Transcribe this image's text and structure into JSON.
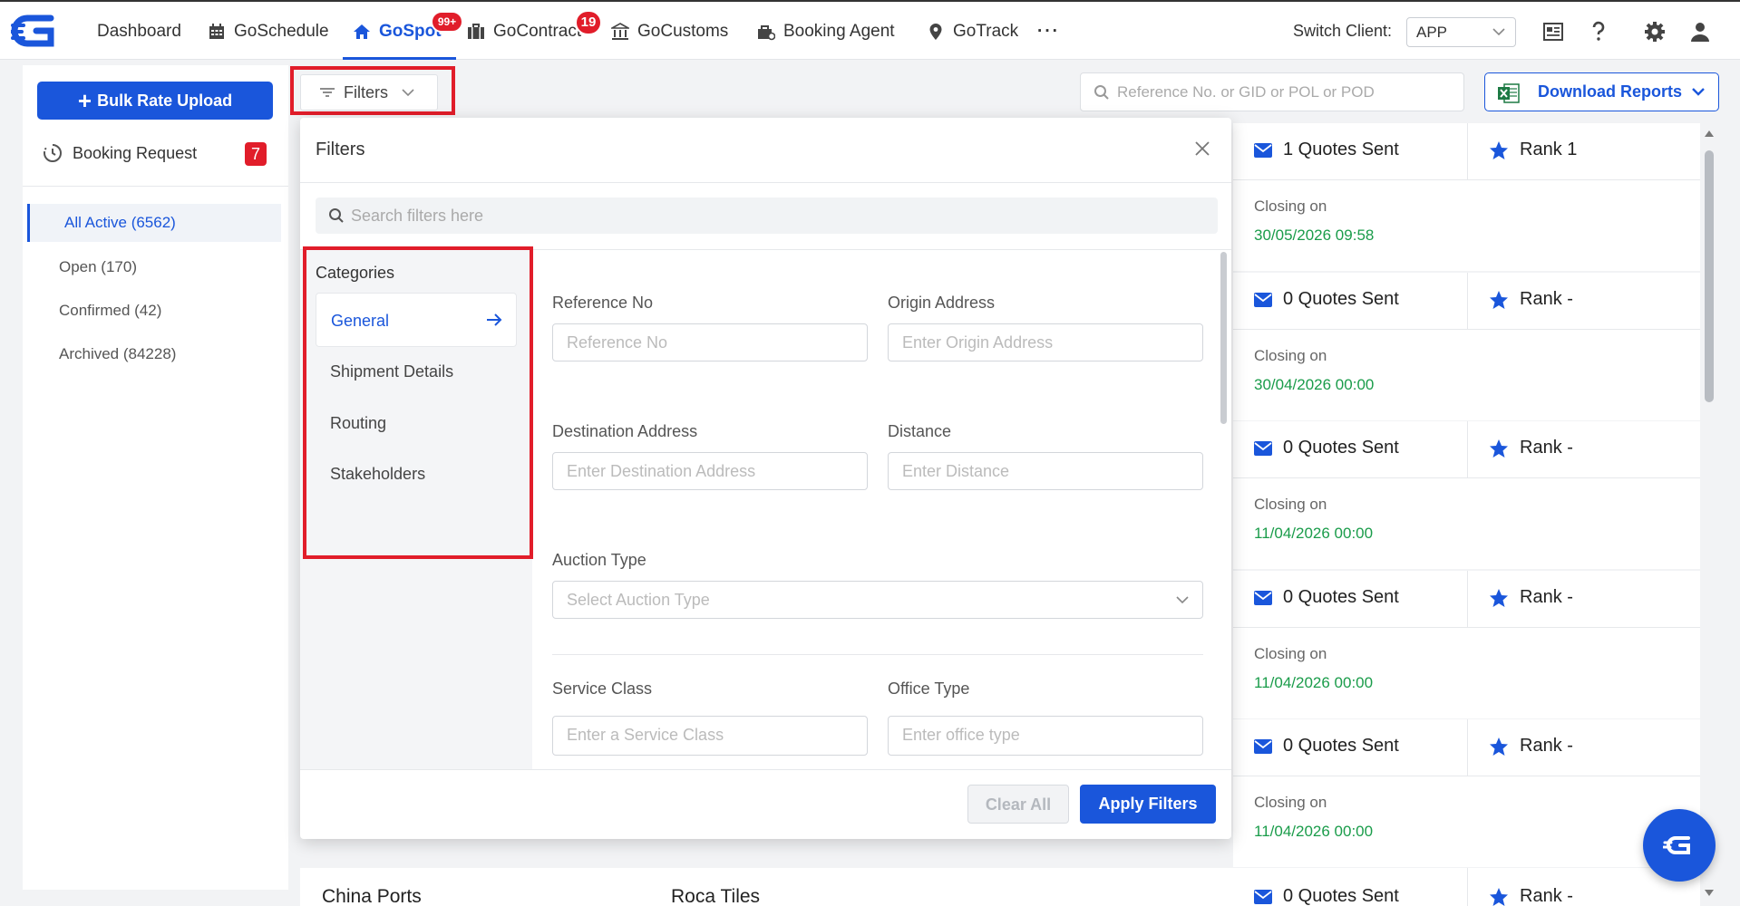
{
  "nav": {
    "items": [
      {
        "label": "Dashboard"
      },
      {
        "label": "GoSchedule"
      },
      {
        "label": "GoSpot",
        "badge": "99+"
      },
      {
        "label": "GoContract",
        "badge": "19"
      },
      {
        "label": "GoCustoms"
      },
      {
        "label": "Booking Agent"
      },
      {
        "label": "GoTrack"
      }
    ],
    "more": "···",
    "switch_client_label": "Switch Client:",
    "switch_client_value": "APP"
  },
  "sidebar": {
    "bulk_button": "Bulk Rate Upload",
    "bulk_plus": "+",
    "booking_request": "Booking Request",
    "booking_request_count": "7",
    "items": [
      {
        "label": "All Active (6562)"
      },
      {
        "label": "Open (170)"
      },
      {
        "label": "Confirmed (42)"
      },
      {
        "label": "Archived (84228)"
      }
    ]
  },
  "toolbar": {
    "filters_label": "Filters",
    "search_placeholder": "Reference No. or GID or POL or POD",
    "download_label": "Download Reports"
  },
  "filters_modal": {
    "title": "Filters",
    "search_placeholder": "Search filters here",
    "categories_heading": "Categories",
    "categories": [
      {
        "label": "General"
      },
      {
        "label": "Shipment Details"
      },
      {
        "label": "Routing"
      },
      {
        "label": "Stakeholders"
      }
    ],
    "fields": {
      "reference_no": {
        "label": "Reference No",
        "placeholder": "Reference No"
      },
      "origin_address": {
        "label": "Origin Address",
        "placeholder": "Enter Origin Address"
      },
      "destination_address": {
        "label": "Destination Address",
        "placeholder": "Enter Destination Address"
      },
      "distance": {
        "label": "Distance",
        "placeholder": "Enter Distance"
      },
      "auction_type": {
        "label": "Auction Type",
        "placeholder": "Select Auction Type"
      },
      "service_class": {
        "label": "Service Class",
        "placeholder": "Enter a Service Class"
      },
      "office_type": {
        "label": "Office Type",
        "placeholder": "Enter office type"
      }
    },
    "clear_all": "Clear All",
    "apply": "Apply Filters"
  },
  "cards": [
    {
      "quotes": "1 Quotes Sent",
      "rank": "Rank 1",
      "closing_label": "Closing on",
      "closing_date": "30/05/2026 09:58"
    },
    {
      "quotes": "0 Quotes Sent",
      "rank": "Rank -",
      "closing_label": "Closing on",
      "closing_date": "30/04/2026 00:00"
    },
    {
      "quotes": "0 Quotes Sent",
      "rank": "Rank -",
      "closing_label": "Closing on",
      "closing_date": "11/04/2026 00:00"
    },
    {
      "quotes": "0 Quotes Sent",
      "rank": "Rank -",
      "closing_label": "Closing on",
      "closing_date": "11/04/2026 00:00"
    },
    {
      "quotes": "0 Quotes Sent",
      "rank": "Rank -",
      "closing_label": "Closing on",
      "closing_date": "11/04/2026 00:00"
    }
  ],
  "bottom_row": {
    "col1": "China Ports",
    "col2": "Roca Tiles",
    "quotes": "0 Quotes Sent",
    "rank": "Rank -"
  },
  "colors": {
    "accent": "#1a56db",
    "badge_red": "#e11d2a",
    "closing_green": "#1a9c4a",
    "highlight_box": "#e11d2a"
  }
}
